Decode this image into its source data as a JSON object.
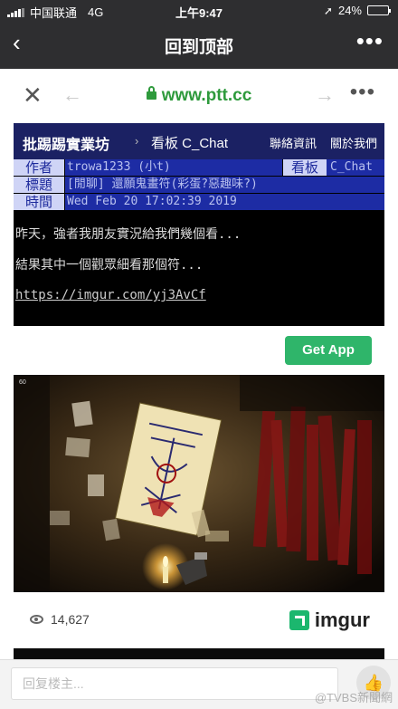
{
  "status_bar": {
    "carrier": "中国联通",
    "network": "4G",
    "time": "上午9:47",
    "battery": "24%",
    "battery_level": 0.24,
    "location_icon": "location-arrow-icon"
  },
  "nav": {
    "back_icon": "back-chevron-icon",
    "title": "回到顶部",
    "more_icon": "more-dots-icon"
  },
  "browser": {
    "close_icon": "close-icon",
    "url": "www.ptt.cc",
    "more_icon": "more-dots-icon"
  },
  "ptt": {
    "site": "批踢踢實業坊",
    "separator": "›",
    "board": "看板 C_Chat",
    "contact": "聯絡資訊",
    "about": "關於我們",
    "meta": {
      "author_label": "作者",
      "author": "trowa1233 (小t)",
      "board_label": "看板",
      "board_value": "C_Chat",
      "title_label": "標題",
      "title": "[閒聊] 還願鬼畫符(彩蛋?惡趣味?)",
      "time_label": "時間",
      "time": "Wed Feb 20 17:02:39 2019"
    },
    "content": [
      "昨天，強者我朋友實況給我們幾個看...",
      "結果其中一個觀眾細看那個符..."
    ],
    "link": "https://imgur.com/yj3AvCf"
  },
  "get_app": "Get App",
  "image": {
    "corner_text": "60"
  },
  "imgur_footer": {
    "views": "14,627",
    "brand": "imgur"
  },
  "reply": {
    "placeholder": "回复楼主...",
    "like_icon": "thumbs-up-icon"
  },
  "watermark": "@TVBS新聞網"
}
